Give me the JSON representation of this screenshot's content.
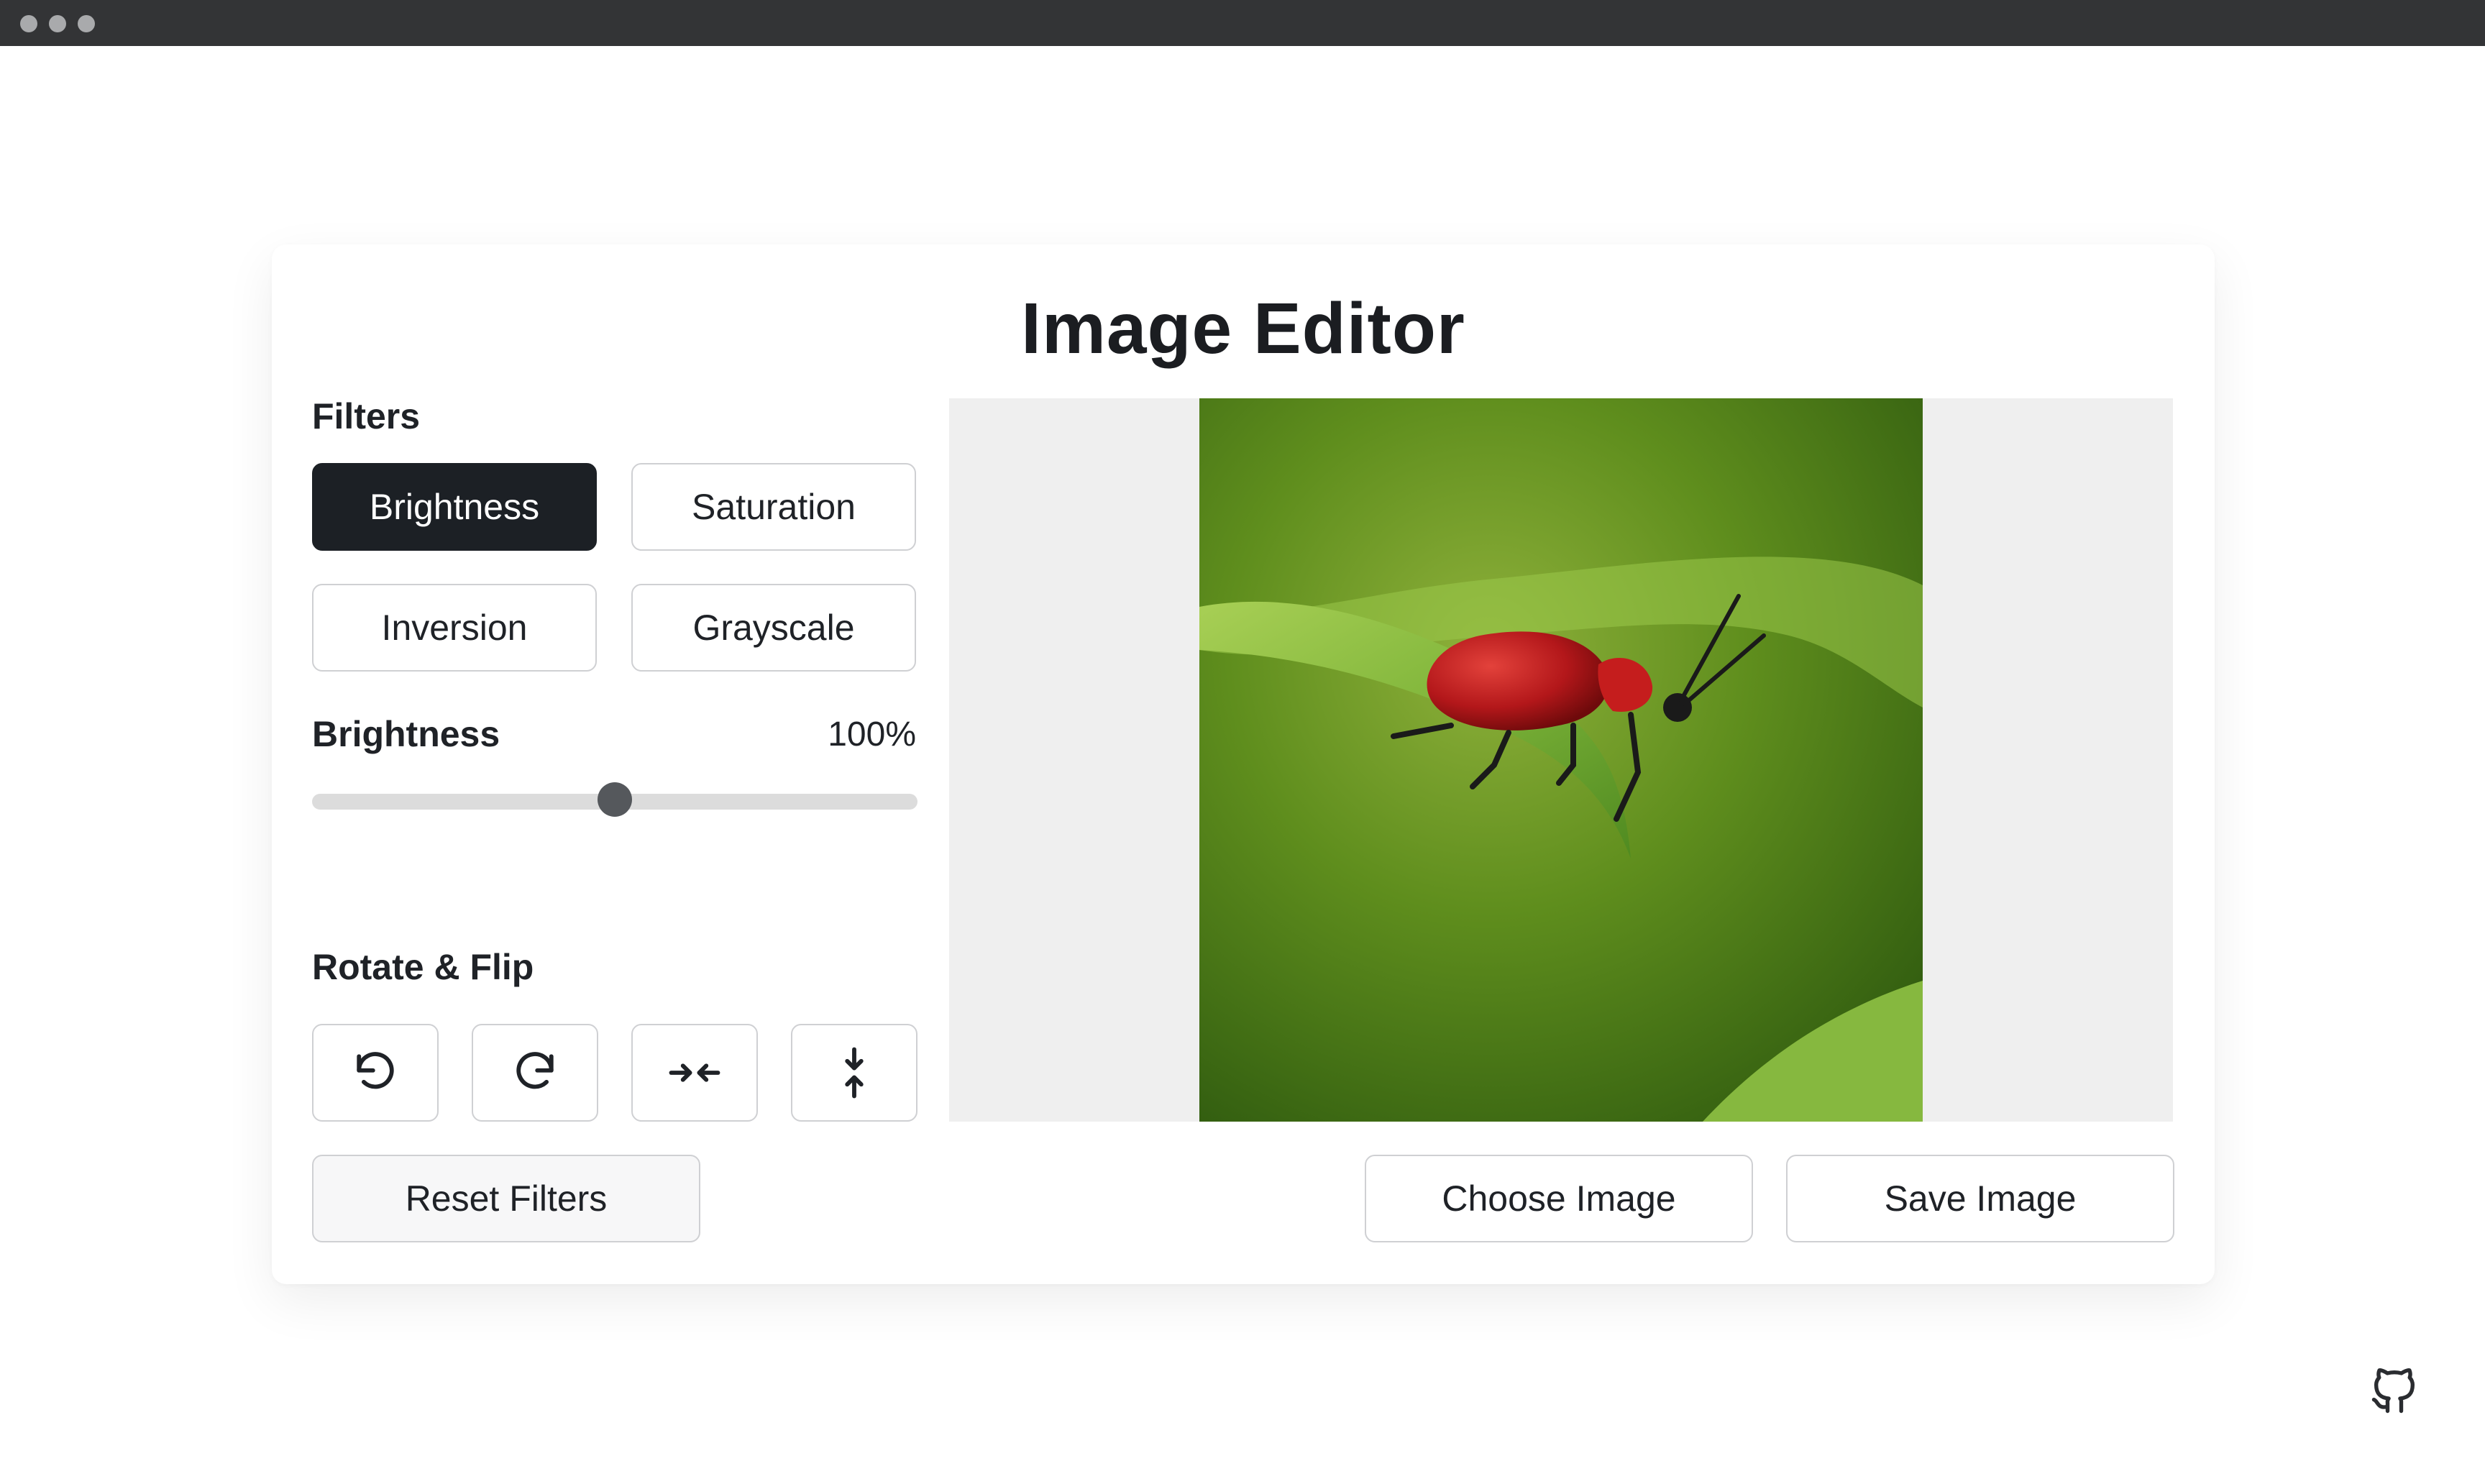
{
  "app": {
    "title": "Image Editor"
  },
  "filters": {
    "heading": "Filters",
    "buttons": [
      "Brightness",
      "Saturation",
      "Inversion",
      "Grayscale"
    ],
    "active": "Brightness",
    "active_label": "Brightness",
    "active_value_text": "100%",
    "slider_fraction": 0.5
  },
  "rotate_flip": {
    "heading": "Rotate & Flip",
    "icons": [
      "rotate-left-icon",
      "rotate-right-icon",
      "flip-horizontal-icon",
      "flip-vertical-icon"
    ]
  },
  "actions": {
    "reset": "Reset Filters",
    "choose": "Choose Image",
    "save": "Save Image"
  },
  "colors": {
    "active_button_bg": "#1c2025",
    "slider_track": "#dcdcdc",
    "slider_thumb": "#55585c",
    "preview_bg": "#efefef"
  },
  "footer": {
    "icon": "github-icon"
  }
}
